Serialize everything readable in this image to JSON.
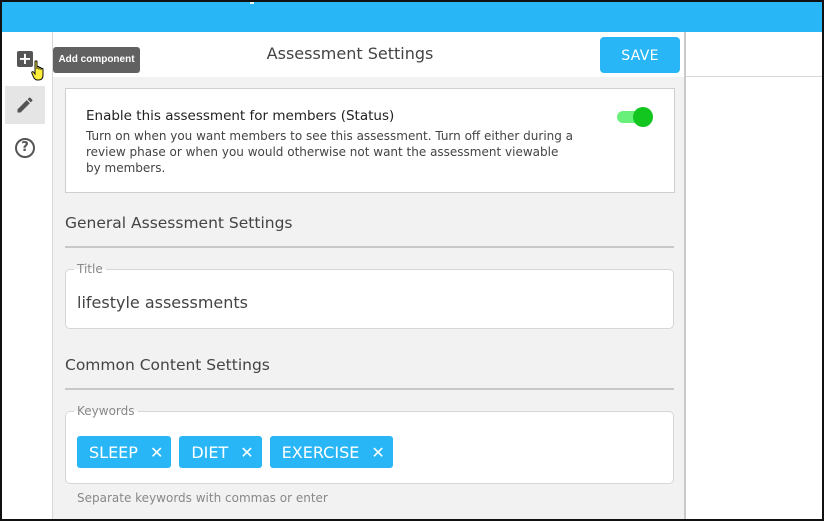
{
  "rail": {
    "add_icon": "plus-icon",
    "edit_icon": "pencil-icon",
    "help_icon": "help-icon"
  },
  "tooltip": {
    "text": "Add component"
  },
  "header": {
    "title": "Assessment Settings",
    "save_label": "SAVE"
  },
  "status": {
    "title": "Enable this assessment for members (Status)",
    "description": "Turn on when you want members to see this assessment. Turn off either during a review phase or when you would otherwise not want the assessment viewable by members.",
    "enabled": true
  },
  "general": {
    "section_title": "General Assessment Settings",
    "title_label": "Title",
    "title_value": "lifestyle assessments"
  },
  "content": {
    "section_title": "Common Content Settings",
    "keywords_label": "Keywords",
    "keywords": [
      "SLEEP",
      "DIET",
      "EXERCISE"
    ],
    "remove_glyph": "✕",
    "helper": "Separate keywords with commas or enter"
  },
  "colors": {
    "accent": "#29b6f6",
    "toggle_on": "#12c51f",
    "tooltip_bg": "#616161"
  }
}
